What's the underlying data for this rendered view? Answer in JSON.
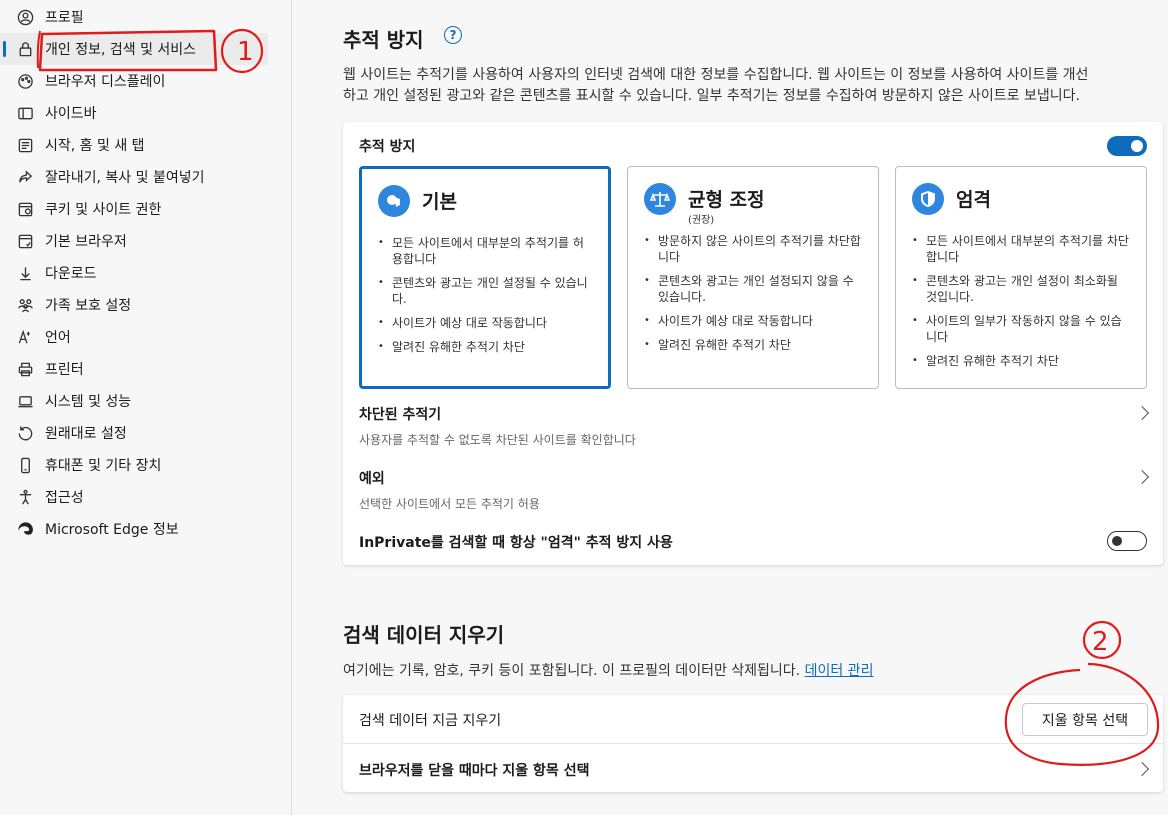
{
  "sidebar": {
    "items": [
      {
        "label": "프로필",
        "icon": "profile-icon"
      },
      {
        "label": "개인 정보, 검색 및 서비스",
        "icon": "lock-icon",
        "active": true
      },
      {
        "label": "브라우저 디스플레이",
        "icon": "display-icon"
      },
      {
        "label": "사이드바",
        "icon": "sidebar-icon"
      },
      {
        "label": "시작, 홈 및 새 탭",
        "icon": "home-icon"
      },
      {
        "label": "잘라내기, 복사 및 붙여넣기",
        "icon": "share-icon"
      },
      {
        "label": "쿠키 및 사이트 권한",
        "icon": "cookie-icon"
      },
      {
        "label": "기본 브라우저",
        "icon": "browser-icon"
      },
      {
        "label": "다운로드",
        "icon": "download-icon"
      },
      {
        "label": "가족 보호 설정",
        "icon": "family-icon"
      },
      {
        "label": "언어",
        "icon": "language-icon"
      },
      {
        "label": "프린터",
        "icon": "printer-icon"
      },
      {
        "label": "시스템 및 성능",
        "icon": "system-icon"
      },
      {
        "label": "원래대로 설정",
        "icon": "reset-icon"
      },
      {
        "label": "휴대폰 및 기타 장치",
        "icon": "phone-icon"
      },
      {
        "label": "접근성",
        "icon": "accessibility-icon"
      },
      {
        "label": "Microsoft Edge 정보",
        "icon": "edge-icon"
      }
    ]
  },
  "tracking": {
    "title": "추적 방지",
    "help": "?",
    "desc_line1": "웹 사이트는 추적기를 사용하여 사용자의 인터넷 검색에 대한 정보를 수집합니다. 웹 사이트는 이 정보를 사용하여 사이트를 개선",
    "desc_line2": "하고 개인 설정된 광고와 같은 콘텐츠를 표시할 수 있습니다. 일부 추적기는 정보를 수집하여 방문하지 않은 사이트로 보냅니다.",
    "toggle_label": "추적 방지",
    "enabled": true,
    "modes": [
      {
        "title": "기본",
        "subtitle": "",
        "bullets": [
          "모든 사이트에서 대부분의 추적기를 허용합니다",
          "콘텐츠와 광고는 개인 설정될 수 있습니다.",
          "사이트가 예상 대로 작동합니다",
          "알려진 유해한 추적기 차단"
        ]
      },
      {
        "title": "균형 조정",
        "subtitle": "(권장)",
        "bullets": [
          "방문하지 않은 사이트의 추적기를 차단합니다",
          "콘텐츠와 광고는 개인 설정되지 않을 수 있습니다.",
          "사이트가 예상 대로 작동합니다",
          "알려진 유해한 추적기 차단"
        ]
      },
      {
        "title": "엄격",
        "subtitle": "",
        "bullets": [
          "모든 사이트에서 대부분의 추적기를 차단합니다",
          "콘텐츠와 광고는 개인 설정이 최소화될 것입니다.",
          "사이트의 일부가 작동하지 않을 수 있습니다",
          "알려진 유해한 추적기 차단"
        ]
      }
    ],
    "blocked_title": "차단된 추적기",
    "blocked_sub": "사용자를 추적할 수 없도록 차단된 사이트를 확인합니다",
    "exceptions_title": "예외",
    "exceptions_sub": "선택한 사이트에서 모든 추적기 허용",
    "inprivate_label": "InPrivate를 검색할 때 항상 \"엄격\" 추적 방지 사용",
    "inprivate_enabled": false
  },
  "clear": {
    "title": "검색 데이터 지우기",
    "desc": "여기에는 기록, 암호, 쿠키 등이 포함됩니다. 이 프로필의 데이터만 삭제됩니다.",
    "link": "데이터 관리",
    "now_label": "검색 데이터 지금 지우기",
    "button": "지울 항목 선택",
    "on_close_label": "브라우저를 닫을 때마다 지울 항목 선택"
  },
  "annotations": {
    "one": "1",
    "two": "2"
  },
  "colors": {
    "accent": "#0f6cbd",
    "annotation": "#e01b1b"
  }
}
